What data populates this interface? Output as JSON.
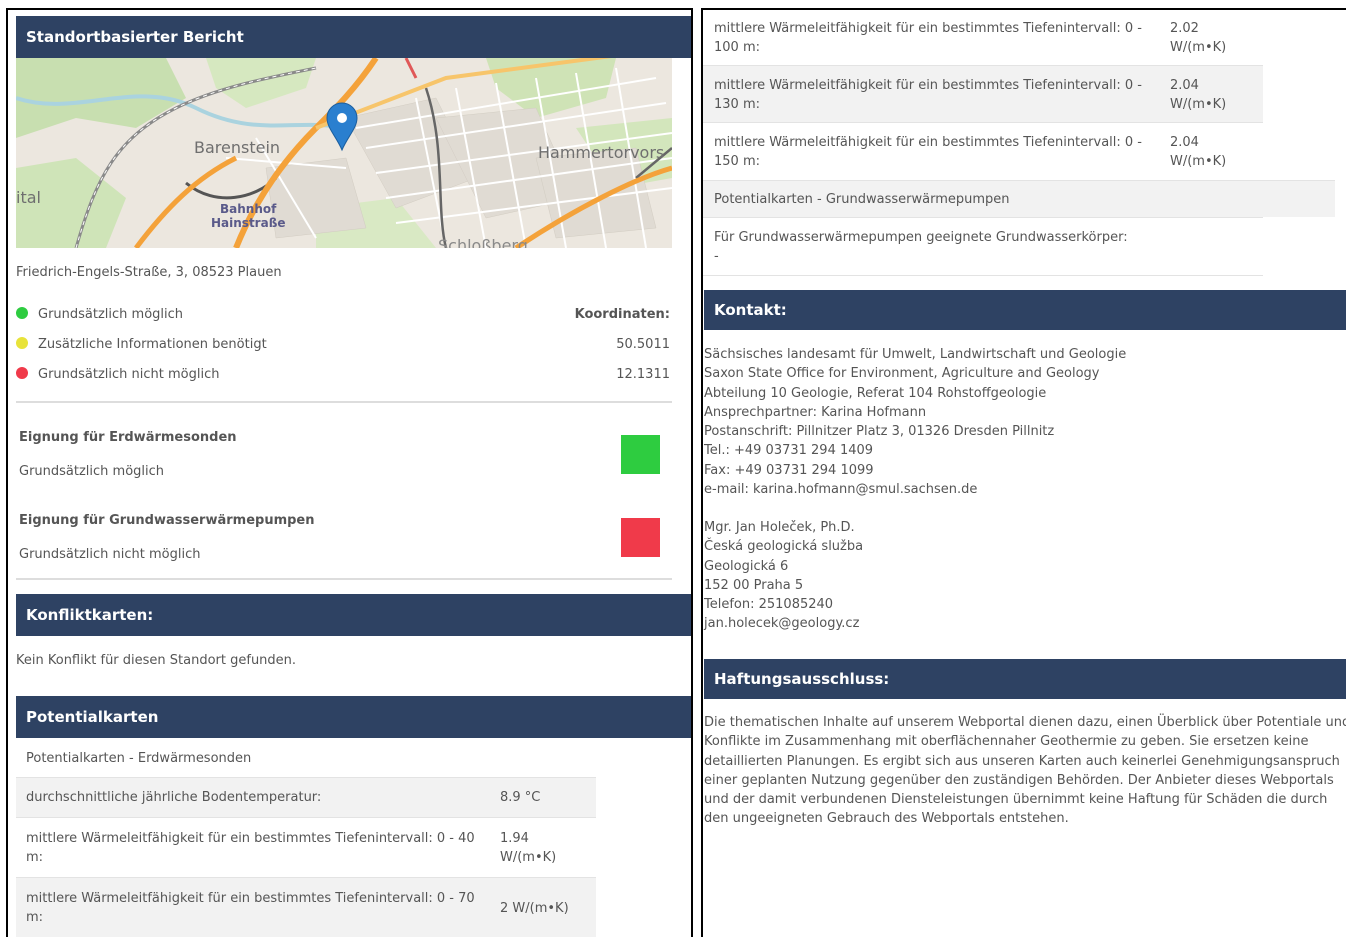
{
  "report": {
    "title": "Standortbasierter Bericht",
    "map": {
      "labels": {
        "barenstein": "Barenstein",
        "hammertorvors": "Hammertorvors",
        "ital": "ital",
        "bahnhof": "Bahnhof",
        "hainstrasse": "Hainstraße",
        "schlossberg": "Schloßberg"
      },
      "colors": {
        "background": "#ece7df",
        "park": "#c8dfb0",
        "primary_road": "#f4a23a",
        "marker": "#2a7fcf"
      }
    },
    "address": "Friedrich-Engels-Straße, 3, 08523 Plauen",
    "legend": [
      {
        "label": "Grundsätzlich möglich",
        "color": "#2ecc40"
      },
      {
        "label": "Zusätzliche Informationen benötigt",
        "color": "#e8e33a"
      },
      {
        "label": "Grundsätzlich nicht möglich",
        "color": "#f03a4a"
      }
    ],
    "coordinates": {
      "label": "Koordinaten:",
      "lat": "50.5011",
      "lon": "12.1311"
    },
    "suitability": [
      {
        "title": "Eignung für Erdwärmesonden",
        "status": "Grundsätzlich möglich",
        "color": "#2ecc40"
      },
      {
        "title": "Eignung für Grundwasserwärmepumpen",
        "status": "Grundsätzlich nicht möglich",
        "color": "#f03a4a"
      }
    ]
  },
  "conflict": {
    "title": "Konfliktkarten:",
    "text": "Kein Konflikt für diesen Standort gefunden."
  },
  "potential": {
    "title": "Potentialkarten",
    "section_erdwaerme": "Potentialkarten - Erdwärmesonden",
    "rows_left": [
      {
        "label": "durchschnittliche jährliche Bodentemperatur:",
        "value": "8.9 °C"
      },
      {
        "label1": "mittlere Wärmeleitfähigkeit für ein bestimmtes Tiefenintervall: 0 - 40",
        "label2": "m:",
        "value1": "1.94",
        "value2": "W/(m•K)"
      },
      {
        "label1": "mittlere Wärmeleitfähigkeit für ein bestimmtes Tiefenintervall: 0 - 70",
        "label2": "m:",
        "value": "2 W/(m•K)"
      }
    ],
    "rows_right": [
      {
        "label1": "mittlere Wärmeleitfähigkeit für ein bestimmtes Tiefenintervall: 0 -",
        "label2": "100 m:",
        "value1": "2.02",
        "value2": "W/(m•K)"
      },
      {
        "label1": "mittlere Wärmeleitfähigkeit für ein bestimmtes Tiefenintervall: 0 -",
        "label2": "130 m:",
        "value1": "2.04",
        "value2": "W/(m•K)"
      },
      {
        "label1": "mittlere Wärmeleitfähigkeit für ein bestimmtes Tiefenintervall: 0 -",
        "label2": "150 m:",
        "value1": "2.04",
        "value2": "W/(m•K)"
      }
    ],
    "section_grundwasser": "Potentialkarten - Grundwasserwärmepumpen",
    "grundwasser_label": "Für Grundwasserwärmepumpen geeignete Grundwasserkörper:",
    "grundwasser_value": "-"
  },
  "contact": {
    "title": "Kontakt:",
    "german": [
      "Sächsisches landesamt für Umwelt, Landwirtschaft und Geologie",
      "Saxon State Office for Environment, Agriculture and Geology",
      "Abteilung 10 Geologie, Referat 104 Rohstoffgeologie",
      "Ansprechpartner: Karina Hofmann",
      "Postanschrift: Pillnitzer Platz 3, 01326 Dresden Pillnitz",
      "Tel.: +49 03731 294 1409",
      "Fax: +49 03731 294 1099",
      "e-mail: karina.hofmann@smul.sachsen.de"
    ],
    "czech": [
      "Mgr. Jan Holeček, Ph.D.",
      "Česká geologická služba",
      "Geologická 6",
      "152 00 Praha 5",
      "Telefon: 251085240",
      "jan.holecek@geology.cz"
    ]
  },
  "disclaimer": {
    "title": "Haftungsausschluss:",
    "lines": [
      "Die thematischen Inhalte auf unserem Webportal dienen dazu, einen Überblick über Potentiale und",
      "Konflikte im Zusammenhang mit oberflächennaher Geothermie zu geben. Sie ersetzen keine",
      "detaillierten Planungen. Es ergibt sich aus unseren Karten auch keinerlei Genehmigungsanspruch",
      "einer geplanten Nutzung gegenüber den zuständigen Behörden. Der Anbieter dieses Webportals",
      "und der damit verbundenen Diensteleistungen übernimmt keine Haftung für Schäden die durch",
      "den ungeeigneten Gebrauch des Webportals entstehen."
    ]
  }
}
